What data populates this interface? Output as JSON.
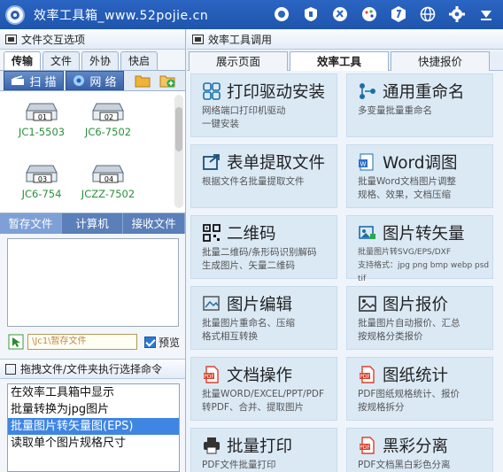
{
  "window": {
    "title": "效率工具箱_www.52pojie.cn"
  },
  "left": {
    "panel_title": "文件交互选项",
    "tabs": [
      "传输",
      "文件",
      "外协",
      "快启"
    ],
    "scan_label": "扫 描",
    "network_label": "网 络",
    "devices": [
      {
        "badge": "01",
        "label": "JC1-5503"
      },
      {
        "badge": "02",
        "label": "JC6-7502"
      },
      {
        "badge": "03",
        "label": "JC6-754"
      },
      {
        "badge": "04",
        "label": "JCZZ-7502"
      }
    ],
    "lower_tabs": [
      "暂存文件",
      "计算机",
      "接收文件"
    ],
    "path_value": "\\Jc1\\暂存文件",
    "preview_label": "预览",
    "drag_title": "拖拽文件/文件夹执行选择命令",
    "commands": [
      "在效率工具箱中显示",
      "批量转换为jpg图片",
      "批量图片转矢量图(EPS)",
      "读取单个图片规格尺寸"
    ],
    "selected_command_index": 2
  },
  "right": {
    "panel_title": "效率工具调用",
    "tabs": [
      "展示页面",
      "效率工具",
      "快捷报价"
    ],
    "tiles": [
      {
        "icon": "print-driver-icon",
        "title": "打印驱动安装",
        "desc": "网络端口打印机驱动\n一键安装"
      },
      {
        "icon": "rename-icon",
        "title": "通用重命名",
        "desc": "多变量批量重命名"
      },
      {
        "icon": "form-extract-icon",
        "title": "表单提取文件",
        "desc": "根据文件名批量提取文件"
      },
      {
        "icon": "word-icon",
        "title": "Word调图",
        "desc": "批量Word文档图片调整\n规格、效果，文档压缩"
      },
      {
        "icon": "qrcode-icon",
        "title": "二维码",
        "desc": "批量二维码/条形码识别解码\n生成图片、矢量二维码"
      },
      {
        "icon": "image-vector-icon",
        "title": "图片转矢量",
        "desc": "批量图片转SVG/EPS/DXF\n支持格式：jpg png bmp webp psd tif"
      },
      {
        "icon": "image-edit-icon",
        "title": "图片编辑",
        "desc": "批量图片重命名、压缩\n格式相互转换"
      },
      {
        "icon": "image-quote-icon",
        "title": "图片报价",
        "desc": "批量图片自动报价、汇总\n按规格分类报价"
      },
      {
        "icon": "document-icon",
        "title": "文档操作",
        "desc": "批量WORD/EXCEL/PPT/PDF\n转PDF、合并、提取图片"
      },
      {
        "icon": "drawing-stats-icon",
        "title": "图纸统计",
        "desc": "PDF图纸规格统计、报价\n按规格拆分"
      },
      {
        "icon": "batch-print-icon",
        "title": "批量打印",
        "desc": "PDF文件批量打印"
      },
      {
        "icon": "bw-split-icon",
        "title": "黑彩分离",
        "desc": "PDF文档黑白彩色分离"
      }
    ]
  }
}
